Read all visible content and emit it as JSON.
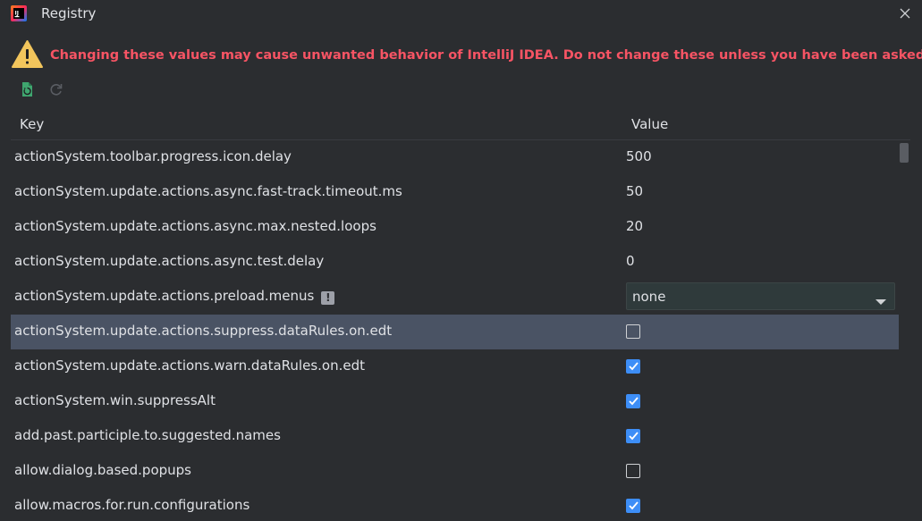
{
  "window": {
    "title": "Registry",
    "app_icon": "intellij-idea-icon",
    "close_icon": "close-icon"
  },
  "warning": {
    "icon": "warning-triangle-icon",
    "text": "Changing these values may cause unwanted behavior of IntelliJ IDEA. Do not change these unless you have been asked to.",
    "color": "#f75464"
  },
  "toolbar": {
    "items": [
      {
        "icon": "restore-defaults-icon",
        "enabled": true
      },
      {
        "icon": "refresh-icon",
        "enabled": false
      }
    ]
  },
  "table": {
    "headers": {
      "key": "Key",
      "value": "Value"
    },
    "rows": [
      {
        "key": "actionSystem.toolbar.progress.icon.delay",
        "type": "text",
        "value": "500"
      },
      {
        "key": "actionSystem.update.actions.async.fast-track.timeout.ms",
        "type": "text",
        "value": "50"
      },
      {
        "key": "actionSystem.update.actions.async.max.nested.loops",
        "type": "text",
        "value": "20"
      },
      {
        "key": "actionSystem.update.actions.async.test.delay",
        "type": "text",
        "value": "0"
      },
      {
        "key": "actionSystem.update.actions.preload.menus",
        "type": "combo",
        "value": "none",
        "badge": "!"
      },
      {
        "key": "actionSystem.update.actions.suppress.dataRules.on.edt",
        "type": "checkbox",
        "checked": false,
        "selected": true
      },
      {
        "key": "actionSystem.update.actions.warn.dataRules.on.edt",
        "type": "checkbox",
        "checked": true
      },
      {
        "key": "actionSystem.win.suppressAlt",
        "type": "checkbox",
        "checked": true
      },
      {
        "key": "add.past.participle.to.suggested.names",
        "type": "checkbox",
        "checked": true
      },
      {
        "key": "allow.dialog.based.popups",
        "type": "checkbox",
        "checked": false
      },
      {
        "key": "allow.macros.for.run.configurations",
        "type": "checkbox",
        "checked": true
      }
    ]
  },
  "colors": {
    "background": "#2b2d30",
    "selection": "#4a5364",
    "checkbox_on": "#3d8ef7",
    "warning_text": "#f75464"
  }
}
